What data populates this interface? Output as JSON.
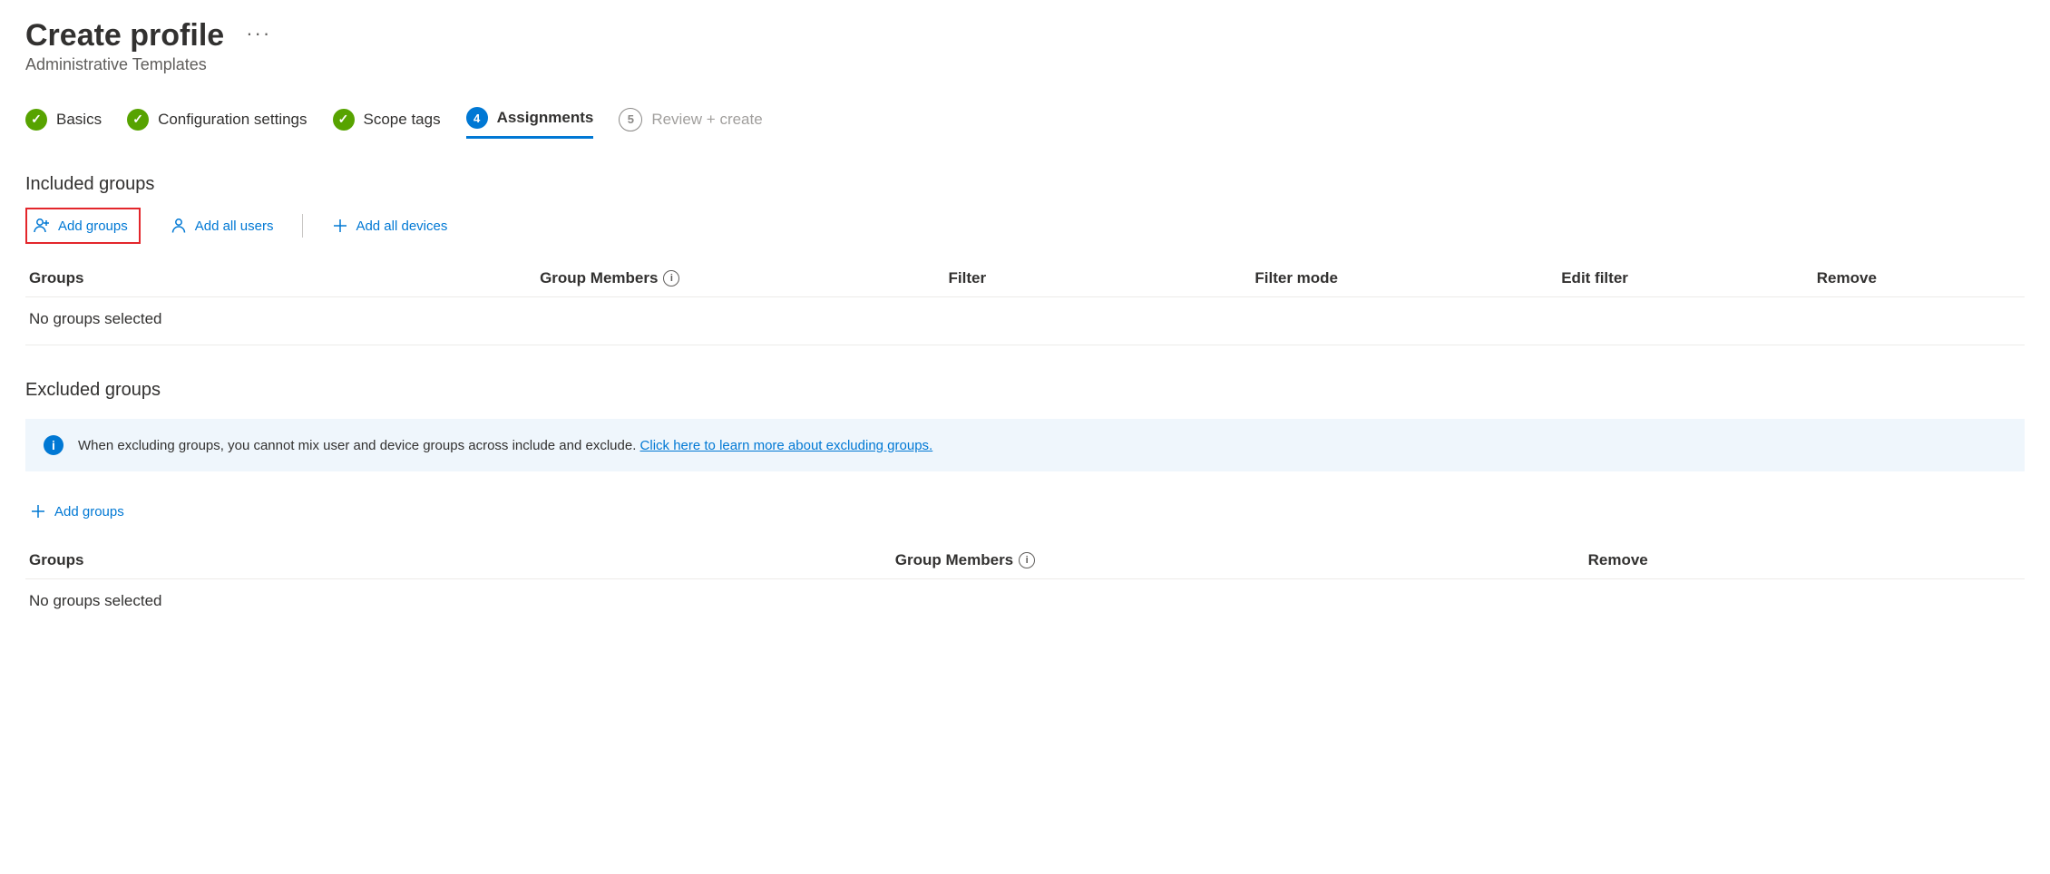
{
  "header": {
    "title": "Create profile",
    "subtitle": "Administrative Templates"
  },
  "steps": {
    "basics": "Basics",
    "config": "Configuration settings",
    "scope": "Scope tags",
    "assign_num": "4",
    "assign": "Assignments",
    "review_num": "5",
    "review": "Review + create"
  },
  "included": {
    "heading": "Included groups",
    "add_groups": "Add groups",
    "add_all_users": "Add all users",
    "add_all_devices": "Add all devices",
    "cols": {
      "groups": "Groups",
      "members": "Group Members",
      "filter": "Filter",
      "filter_mode": "Filter mode",
      "edit_filter": "Edit filter",
      "remove": "Remove"
    },
    "empty": "No groups selected"
  },
  "excluded": {
    "heading": "Excluded groups",
    "banner_text": "When excluding groups, you cannot mix user and device groups across include and exclude. ",
    "banner_link": "Click here to learn more about excluding groups.",
    "add_groups": "Add groups",
    "cols": {
      "groups": "Groups",
      "members": "Group Members",
      "remove": "Remove"
    },
    "empty": "No groups selected"
  }
}
